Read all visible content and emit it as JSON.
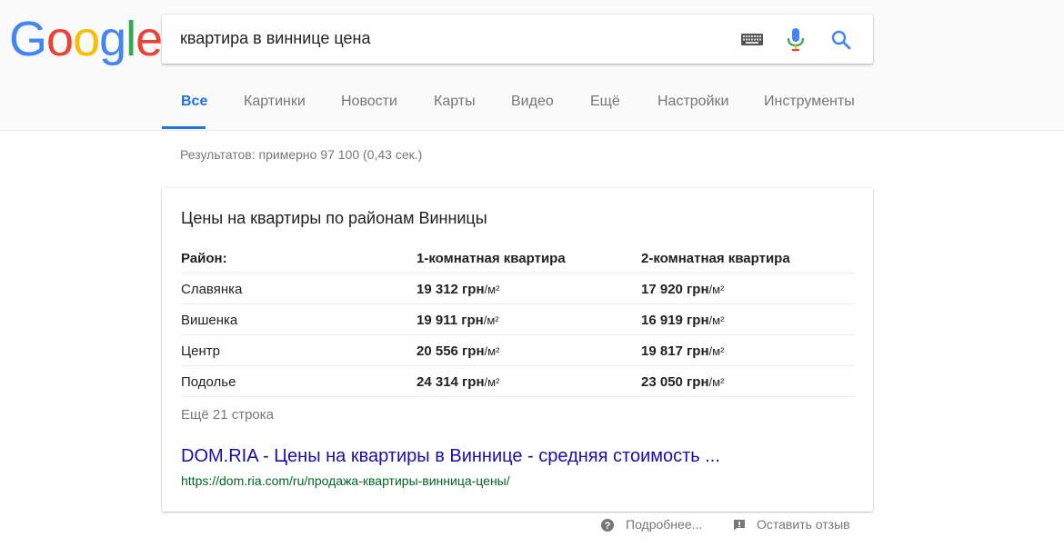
{
  "logo": {
    "letters": [
      "G",
      "o",
      "o",
      "g",
      "l",
      "e"
    ],
    "colors": [
      "#4285F4",
      "#EA4335",
      "#FBBC05",
      "#4285F4",
      "#34A853",
      "#EA4335"
    ]
  },
  "search": {
    "query": "квартира в виннице цена",
    "icons": [
      "keyboard-icon",
      "mic-icon",
      "search-icon"
    ]
  },
  "tabs": [
    "Все",
    "Картинки",
    "Новости",
    "Карты",
    "Видео",
    "Ещё",
    "Настройки",
    "Инструменты"
  ],
  "active_tab": "Все",
  "stats": "Результатов: примерно 97 100 (0,43 сек.)",
  "snippet": {
    "title": "Цены на квартиры по районам Винницы",
    "headers": [
      "Район:",
      "1-комнатная квартира",
      "2-комнатная квартира"
    ],
    "rows": [
      {
        "district": "Славянка",
        "one_room": "19 312 грн",
        "two_room": "17 920 грн"
      },
      {
        "district": "Вишенка",
        "one_room": "19 911 грн",
        "two_room": "16 919 грн"
      },
      {
        "district": "Центр",
        "one_room": "20 556 грн",
        "two_room": "19 817 грн"
      },
      {
        "district": "Подолье",
        "one_room": "24 314 грн",
        "two_room": "23 050 грн"
      }
    ],
    "unit": "/м²",
    "more_rows": "Ещё 21 строка",
    "link_title": "DOM.RIA - Цены на квартиры в Виннице - средняя стоимость ...",
    "link_url": "https://dom.ria.com/ru/продажа-квартиры-винница-цены/"
  },
  "footer": {
    "about": "Подробнее...",
    "feedback": "Оставить отзыв"
  },
  "colors": {
    "link": "#1a0dab",
    "url": "#006621",
    "active_tab": "#1a73e8",
    "muted": "#777777"
  }
}
